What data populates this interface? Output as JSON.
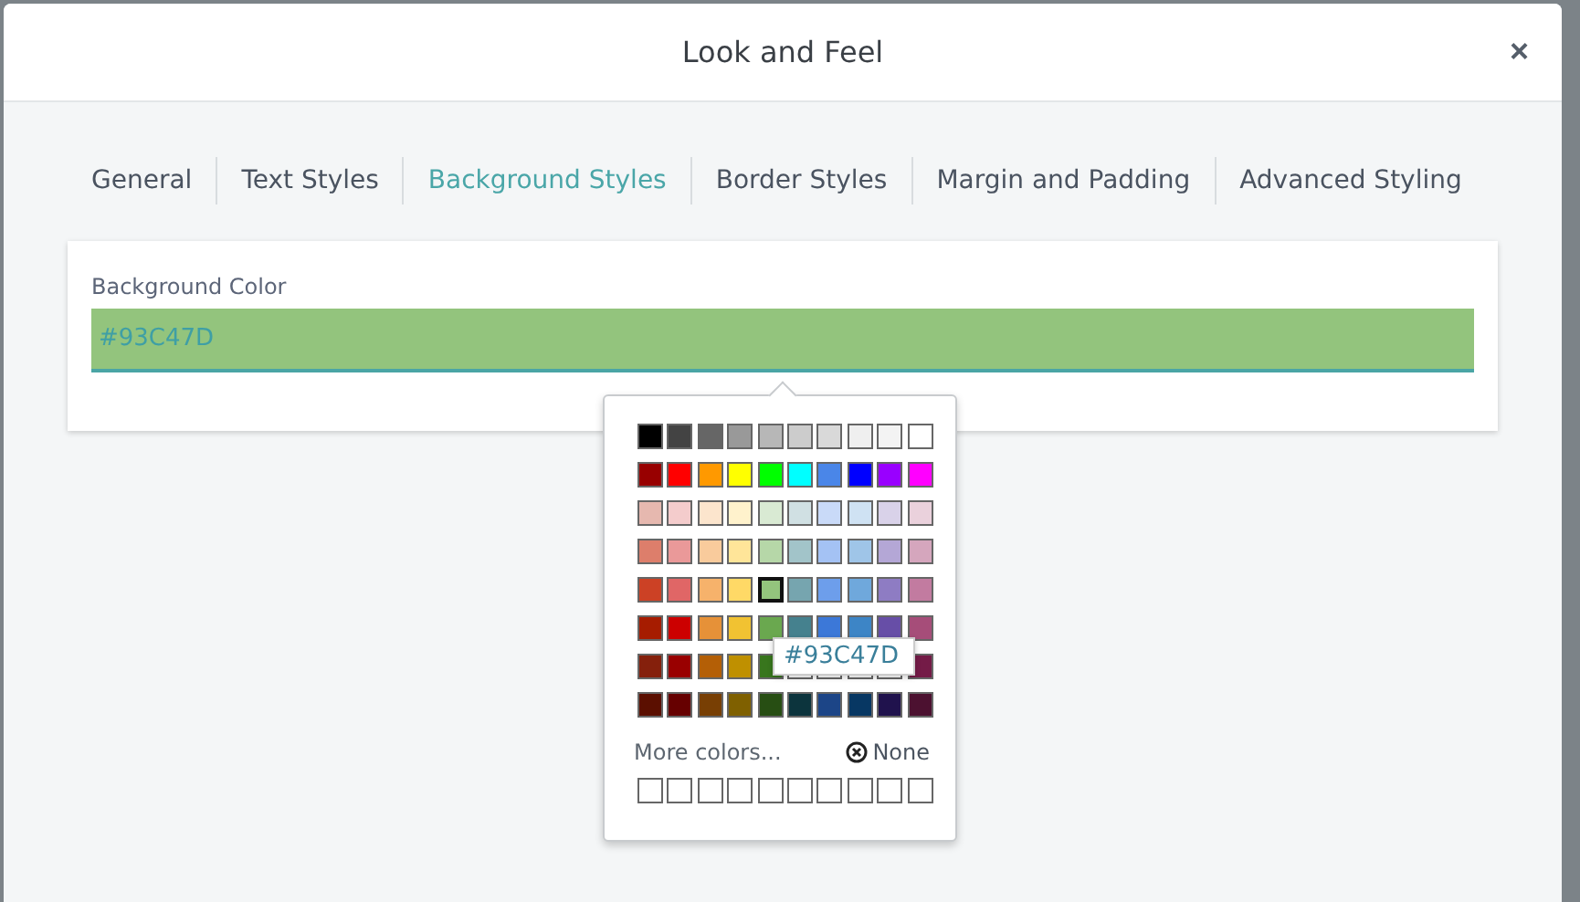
{
  "dialog": {
    "title": "Look and Feel",
    "close": "×"
  },
  "tabs": [
    {
      "label": "General",
      "selected": false
    },
    {
      "label": "Text Styles",
      "selected": false
    },
    {
      "label": "Background Styles",
      "selected": true
    },
    {
      "label": "Border Styles",
      "selected": false
    },
    {
      "label": "Margin and Padding",
      "selected": false
    },
    {
      "label": "Advanced Styling",
      "selected": false
    }
  ],
  "field": {
    "label": "Background Color",
    "value": "#93C47D",
    "color": "#93c47d"
  },
  "palette": {
    "rows": [
      [
        {
          "color": "#000000",
          "selected": false
        },
        {
          "color": "#434343",
          "selected": false
        },
        {
          "color": "#666666",
          "selected": false
        },
        {
          "color": "#999999",
          "selected": false
        },
        {
          "color": "#b7b7b7",
          "selected": false
        },
        {
          "color": "#cccccc",
          "selected": false
        },
        {
          "color": "#d9d9d9",
          "selected": false
        },
        {
          "color": "#efefef",
          "selected": false
        },
        {
          "color": "#f3f3f3",
          "selected": false
        },
        {
          "color": "#ffffff",
          "selected": false
        }
      ],
      [
        {
          "color": "#980000",
          "selected": false
        },
        {
          "color": "#ff0000",
          "selected": false
        },
        {
          "color": "#ff9900",
          "selected": false
        },
        {
          "color": "#ffff00",
          "selected": false
        },
        {
          "color": "#00ff00",
          "selected": false
        },
        {
          "color": "#00ffff",
          "selected": false
        },
        {
          "color": "#4a86e8",
          "selected": false
        },
        {
          "color": "#0000ff",
          "selected": false
        },
        {
          "color": "#9900ff",
          "selected": false
        },
        {
          "color": "#ff00ff",
          "selected": false
        }
      ],
      [
        {
          "color": "#e6b8af",
          "selected": false
        },
        {
          "color": "#f4cccc",
          "selected": false
        },
        {
          "color": "#fce5cd",
          "selected": false
        },
        {
          "color": "#fff2cc",
          "selected": false
        },
        {
          "color": "#d9ead3",
          "selected": false
        },
        {
          "color": "#d0e0e3",
          "selected": false
        },
        {
          "color": "#c9daf8",
          "selected": false
        },
        {
          "color": "#cfe2f3",
          "selected": false
        },
        {
          "color": "#d9d2e9",
          "selected": false
        },
        {
          "color": "#ead1dc",
          "selected": false
        }
      ],
      [
        {
          "color": "#dd7e6b",
          "selected": false
        },
        {
          "color": "#ea9999",
          "selected": false
        },
        {
          "color": "#f9cb9c",
          "selected": false
        },
        {
          "color": "#ffe599",
          "selected": false
        },
        {
          "color": "#b6d7a8",
          "selected": false
        },
        {
          "color": "#a2c4c9",
          "selected": false
        },
        {
          "color": "#a4c2f4",
          "selected": false
        },
        {
          "color": "#9fc5e8",
          "selected": false
        },
        {
          "color": "#b4a7d6",
          "selected": false
        },
        {
          "color": "#d5a6bd",
          "selected": false
        }
      ],
      [
        {
          "color": "#cc4125",
          "selected": false
        },
        {
          "color": "#e06666",
          "selected": false
        },
        {
          "color": "#f6b26b",
          "selected": false
        },
        {
          "color": "#ffd966",
          "selected": false
        },
        {
          "color": "#93c47d",
          "selected": true
        },
        {
          "color": "#76a5af",
          "selected": false
        },
        {
          "color": "#6d9eeb",
          "selected": false
        },
        {
          "color": "#6fa8dc",
          "selected": false
        },
        {
          "color": "#8e7cc3",
          "selected": false
        },
        {
          "color": "#c27ba0",
          "selected": false
        }
      ],
      [
        {
          "color": "#a61c00",
          "selected": false
        },
        {
          "color": "#cc0000",
          "selected": false
        },
        {
          "color": "#e69138",
          "selected": false
        },
        {
          "color": "#f1c232",
          "selected": false
        },
        {
          "color": "#6aa84f",
          "selected": false
        },
        {
          "color": "#45818e",
          "selected": false
        },
        {
          "color": "#3c78d8",
          "selected": false
        },
        {
          "color": "#3d85c6",
          "selected": false
        },
        {
          "color": "#674ea7",
          "selected": false
        },
        {
          "color": "#a64d79",
          "selected": false
        }
      ],
      [
        {
          "color": "#85200c",
          "selected": false
        },
        {
          "color": "#990000",
          "selected": false
        },
        {
          "color": "#b45f06",
          "selected": false
        },
        {
          "color": "#bf9000",
          "selected": false
        },
        {
          "color": "#38761d",
          "selected": false
        },
        {
          "selected": false
        },
        {
          "selected": false
        },
        {
          "selected": false
        },
        {
          "selected": false
        },
        {
          "color": "#741b47",
          "selected": false
        }
      ],
      [
        {
          "color": "#5b0f00",
          "selected": false
        },
        {
          "color": "#660000",
          "selected": false
        },
        {
          "color": "#783f04",
          "selected": false
        },
        {
          "color": "#7f6000",
          "selected": false
        },
        {
          "color": "#274e13",
          "selected": false
        },
        {
          "color": "#0c343d",
          "selected": false
        },
        {
          "color": "#1c4587",
          "selected": false
        },
        {
          "color": "#073763",
          "selected": false
        },
        {
          "color": "#20124d",
          "selected": false
        },
        {
          "color": "#4c1130",
          "selected": false
        }
      ]
    ],
    "tooltip": "#93C47D",
    "more_colors": "More colors...",
    "none": "None",
    "custom": [
      {
        "filled": false
      },
      {
        "filled": false
      },
      {
        "filled": false
      },
      {
        "filled": false
      },
      {
        "filled": false
      },
      {
        "filled": false
      },
      {
        "filled": false
      },
      {
        "filled": false
      },
      {
        "filled": false
      },
      {
        "filled": false
      }
    ]
  }
}
